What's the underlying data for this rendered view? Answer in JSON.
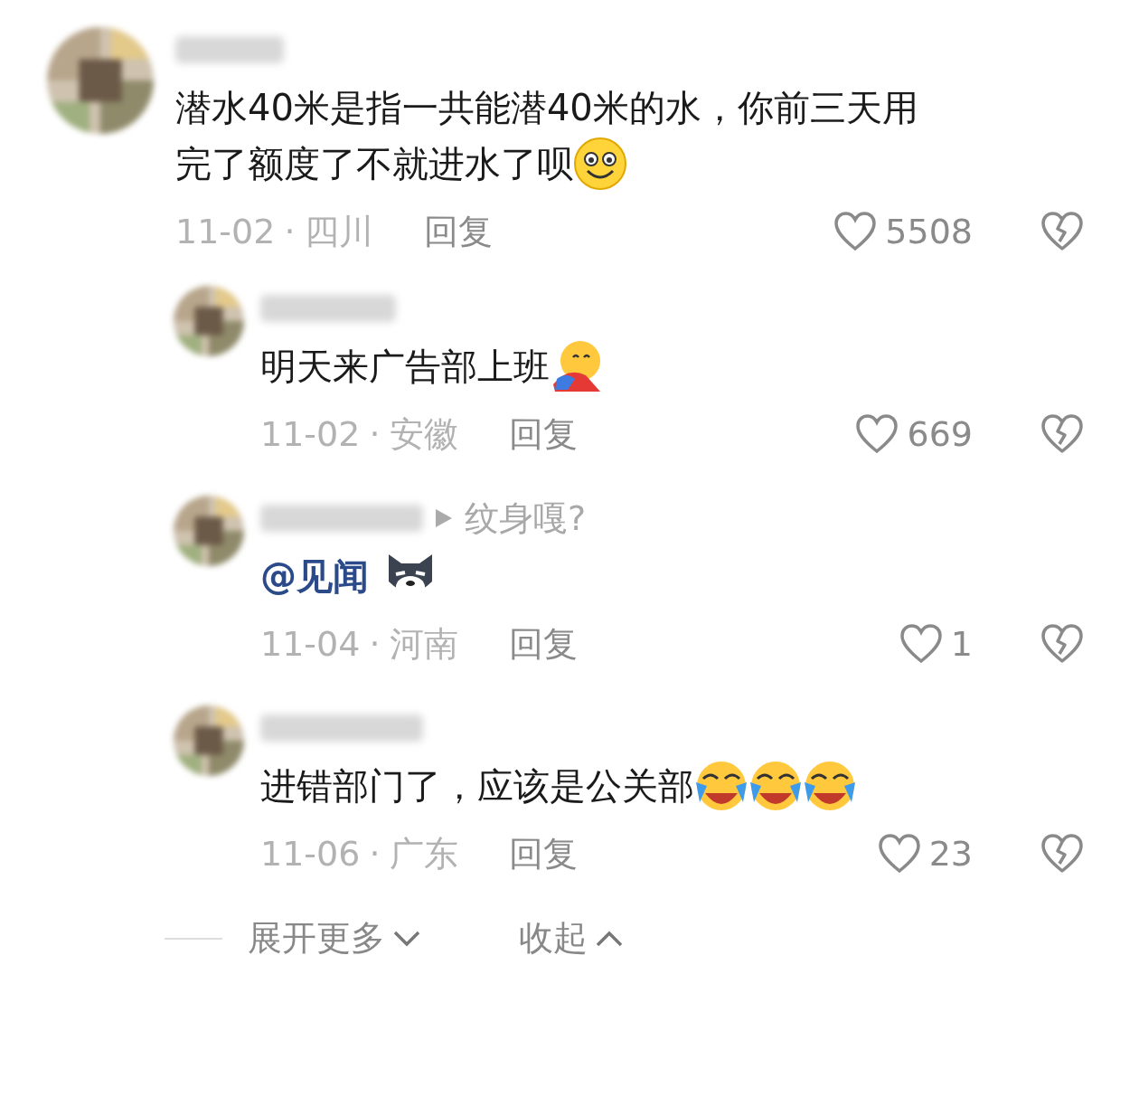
{
  "comment": {
    "lines": [
      "潜水40米是指一共能潜40米的水，你前三天用",
      "完了额度了不就进水了呗"
    ],
    "emojis": [
      {
        "kind": "smile"
      }
    ],
    "date": "11-02",
    "separator": "·",
    "region": "四川",
    "reply_label": "回复",
    "likes": "5508"
  },
  "replies": [
    {
      "lines": [
        "明天来广告部上班"
      ],
      "emojis": [
        {
          "kind": "hug"
        }
      ],
      "date": "11-02",
      "separator": "·",
      "region": "安徽",
      "reply_label": "回复",
      "likes": "669"
    },
    {
      "reply_to": "纹身嘎?",
      "mention": "@见闻",
      "emojis": [
        {
          "kind": "wolf"
        }
      ],
      "date": "11-04",
      "separator": "·",
      "region": "河南",
      "reply_label": "回复",
      "likes": "1"
    },
    {
      "lines": [
        "进错部门了，应该是公关部"
      ],
      "emojis": [
        {
          "kind": "laugh-cry"
        },
        {
          "kind": "laugh-cry"
        },
        {
          "kind": "laugh-cry"
        }
      ],
      "date": "11-06",
      "separator": "·",
      "region": "广东",
      "reply_label": "回复",
      "likes": "23"
    }
  ],
  "footer": {
    "expand": "展开更多",
    "collapse": "收起"
  }
}
